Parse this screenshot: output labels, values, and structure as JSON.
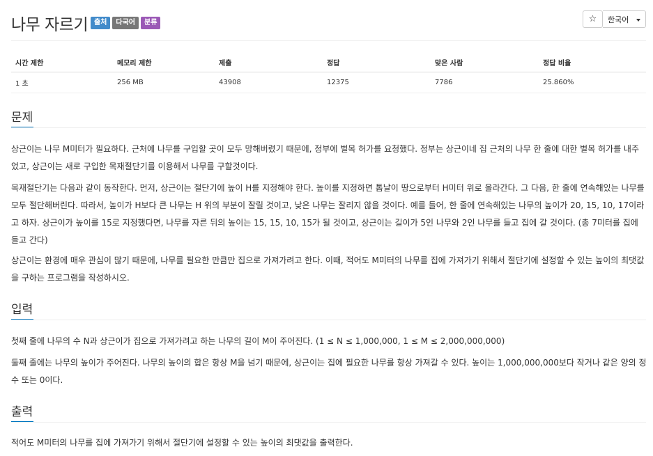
{
  "problem": {
    "title": "나무 자르기",
    "badges": [
      {
        "label": "출처",
        "color": "#428bca"
      },
      {
        "label": "다국어",
        "color": "#777777"
      },
      {
        "label": "분류",
        "color": "#9b59b6"
      }
    ],
    "star_icon": "☆",
    "language": "한국어"
  },
  "stats": {
    "headers": [
      "시간 제한",
      "메모리 제한",
      "제출",
      "정답",
      "맞은 사람",
      "정답 비율"
    ],
    "values": [
      "1 초",
      "256 MB",
      "43908",
      "12375",
      "7786",
      "25.860%"
    ]
  },
  "sections": {
    "problem_heading": "문제",
    "problem_p1": "상근이는 나무 M미터가 필요하다. 근처에 나무를 구입할 곳이 모두 망해버렸기 때문에, 정부에 벌목 허가를 요청했다. 정부는 상근이네 집 근처의 나무 한 줄에 대한 벌목 허가를 내주었고, 상근이는 새로 구입한 목재절단기를 이용해서 나무를 구할것이다.",
    "problem_p2": "목재절단기는 다음과 같이 동작한다. 먼저, 상근이는 절단기에 높이 H를 지정해야 한다. 높이를 지정하면 톱날이 땅으로부터 H미터 위로 올라간다. 그 다음, 한 줄에 연속해있는 나무를 모두 절단해버린다. 따라서, 높이가 H보다 큰 나무는 H 위의 부분이 잘릴 것이고, 낮은 나무는 잘리지 않을 것이다. 예를 들어, 한 줄에 연속해있는 나무의 높이가 20, 15, 10, 17이라고 하자. 상근이가 높이를 15로 지정했다면, 나무를 자른 뒤의 높이는 15, 15, 10, 15가 될 것이고, 상근이는 길이가 5인 나무와 2인 나무를 들고 집에 갈 것이다. (총 7미터를 집에 들고 간다)",
    "problem_p3": "상근이는 환경에 매우 관심이 많기 때문에, 나무를 필요한 만큼만 집으로 가져가려고 한다. 이때, 적어도 M미터의 나무를 집에 가져가기 위해서 절단기에 설정할 수 있는 높이의 최댓값을 구하는 프로그램을 작성하시오.",
    "input_heading": "입력",
    "input_p1": "첫째 줄에 나무의 수 N과 상근이가 집으로 가져가려고 하는 나무의 길이 M이 주어진다. (1 ≤ N ≤ 1,000,000, 1 ≤ M ≤ 2,000,000,000)",
    "input_p2": "둘째 줄에는 나무의 높이가 주어진다. 나무의 높이의 합은 항상 M을 넘기 때문에, 상근이는 집에 필요한 나무를 항상 가져갈 수 있다. 높이는 1,000,000,000보다 작거나 같은 양의 정수 또는 0이다.",
    "output_heading": "출력",
    "output_p1": "적어도 M미터의 나무를 집에 가져가기 위해서 절단기에 설정할 수 있는 높이의 최댓값을 출력한다."
  }
}
